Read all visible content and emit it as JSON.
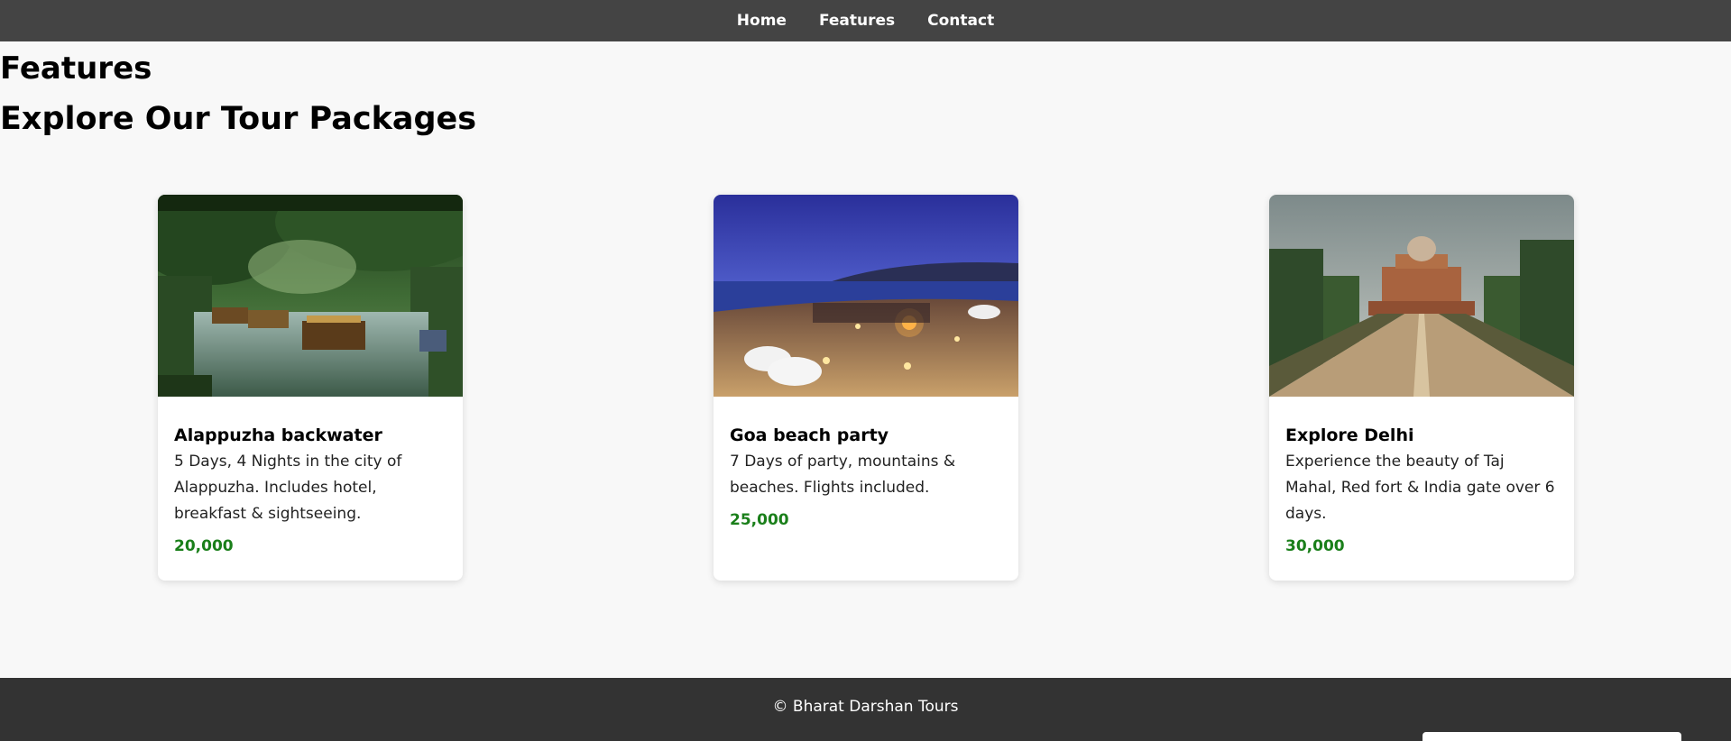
{
  "nav": {
    "items": [
      {
        "label": "Home"
      },
      {
        "label": "Features"
      },
      {
        "label": "Contact"
      }
    ]
  },
  "main": {
    "section_title": "Features",
    "subtitle": "Explore Our Tour Packages"
  },
  "cards": [
    {
      "title": "Alappuzha backwater",
      "description": "5 Days, 4 Nights in the city of Alappuzha. Includes hotel, breakfast & sightseeing.",
      "price": "20,000"
    },
    {
      "title": "Goa beach party",
      "description": "7 Days of party, mountains & beaches. Flights included.",
      "price": "25,000"
    },
    {
      "title": "Explore Delhi",
      "description": "Experience the beauty of Taj Mahal, Red fort & India gate over 6 days.",
      "price": "30,000"
    }
  ],
  "footer": {
    "text": "© Bharat Darshan Tours"
  },
  "colors": {
    "nav_bg": "#444444",
    "footer_bg": "#333333",
    "price": "#1a7f1a",
    "page_bg": "#f8f8f8"
  }
}
